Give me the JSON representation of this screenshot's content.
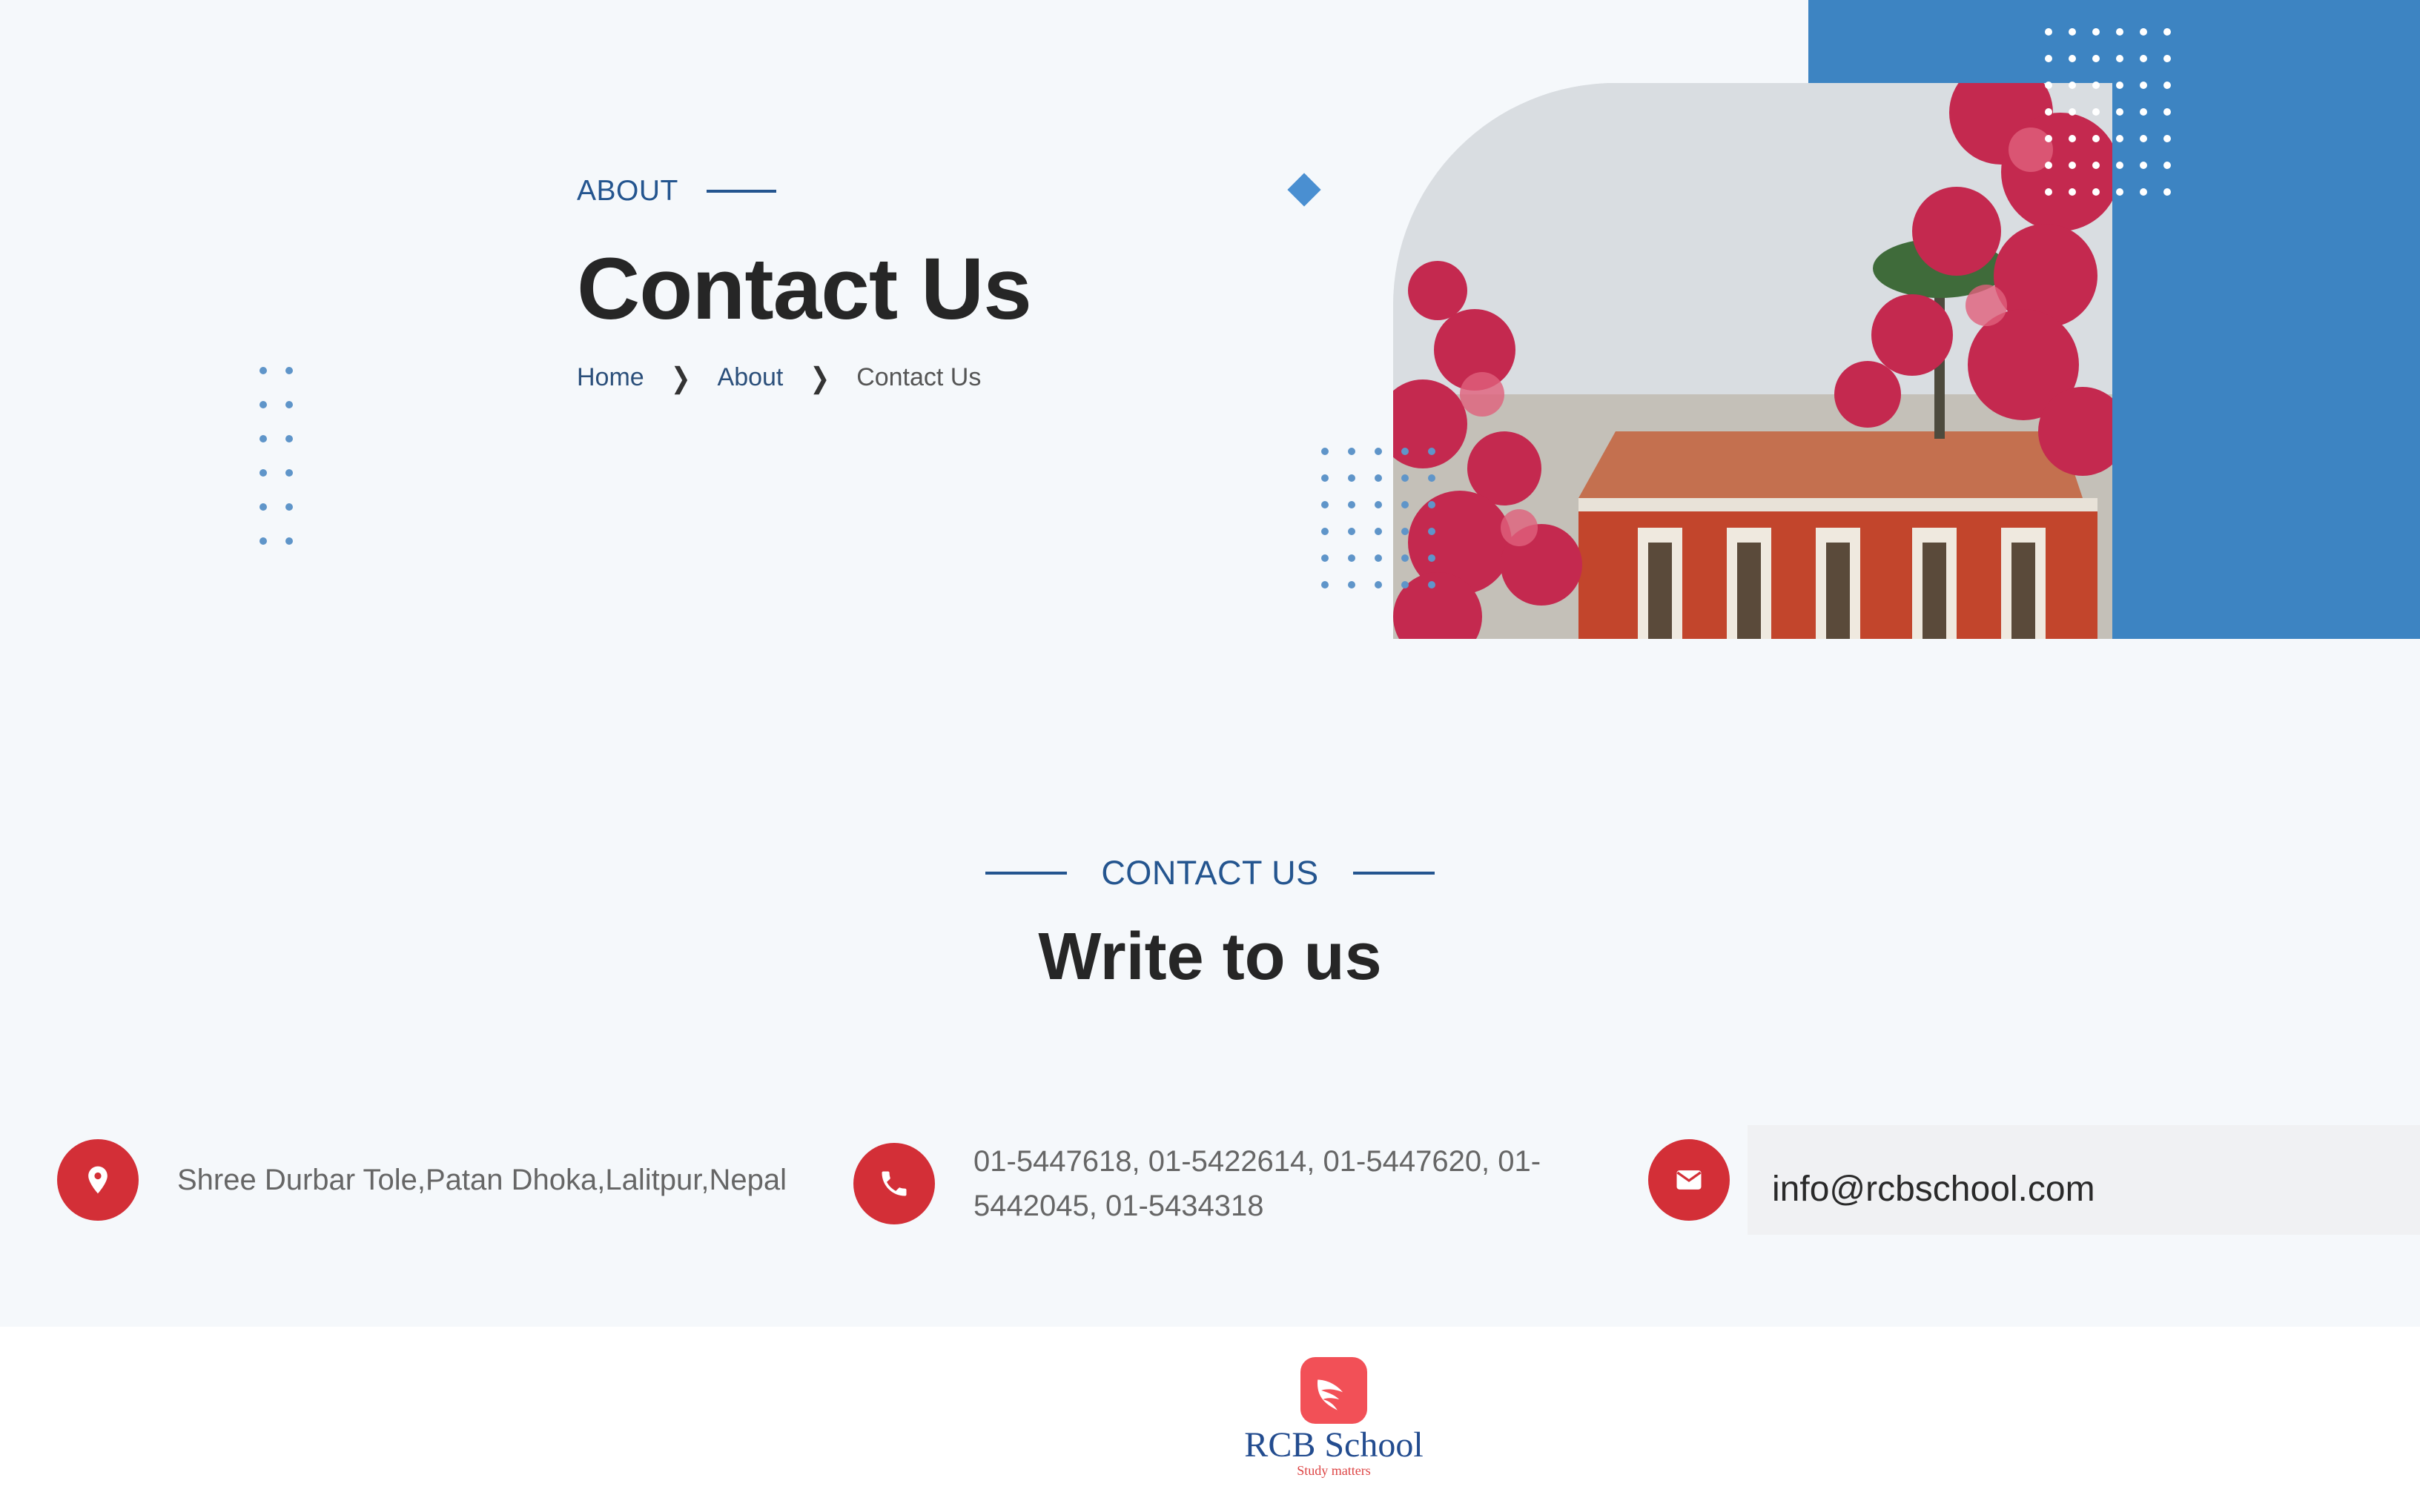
{
  "hero": {
    "eyebrow": "ABOUT",
    "title": "Contact Us",
    "breadcrumb": [
      {
        "label": "Home"
      },
      {
        "label": "About"
      },
      {
        "label": "Contact Us"
      }
    ],
    "image_alt": "school-building-with-blossoms"
  },
  "section": {
    "eyebrow": "CONTACT US",
    "title": "Write to us"
  },
  "contacts": {
    "address": "Shree Durbar Tole,Patan Dhoka,Lalitpur,Nepal",
    "phone_line1": "01-5447618, 01-5422614, 01-5447620, 01-",
    "phone_line2": "5442045, 01-5434318",
    "email": "info@rcbschool.com"
  },
  "footer": {
    "brand": "RCB School",
    "tagline": "Study matters"
  },
  "colors": {
    "accent_blue": "#3d84c2",
    "accent_red": "#d32f37",
    "logo_red": "#f25057",
    "text_navy": "#24558f"
  },
  "icons": [
    "location-pin-icon",
    "phone-icon",
    "mail-icon",
    "wing-logo-icon",
    "chevron-right-icon"
  ]
}
